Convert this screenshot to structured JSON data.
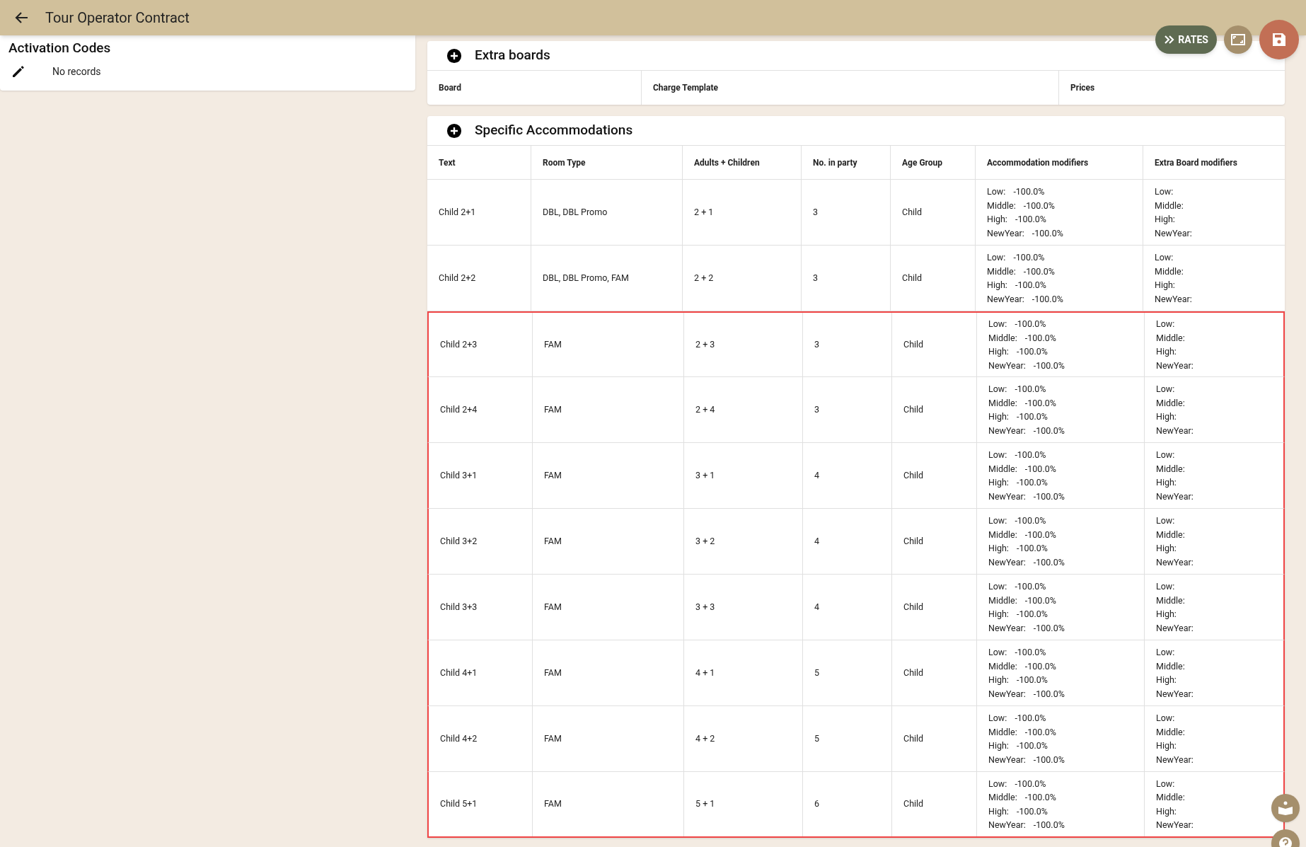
{
  "app_bar": {
    "title": "Tour Operator Contract"
  },
  "actions": [
    {
      "kind": "rates",
      "label": "RATES"
    },
    {
      "kind": "fullscreen"
    },
    {
      "kind": "save"
    }
  ],
  "activation_codes": {
    "title": "Activation Codes",
    "empty_text": "No records"
  },
  "extra_boards": {
    "title": "Extra boards",
    "columns": [
      "Board",
      "Charge Template",
      "Prices"
    ]
  },
  "specific_accommodations": {
    "title": "Specific Accommodations",
    "columns": [
      "Text",
      "Room Type",
      "Adults + Children",
      "No. in party",
      "Age Group",
      "Accommodation modifiers",
      "Extra Board modifiers"
    ],
    "rows": [
      {
        "text": "Child 2+1",
        "room_type": "DBL, DBL Promo",
        "adults_children": "2 + 1",
        "party": "3",
        "age_group": "Child",
        "highlighted": false,
        "acc_modifiers": [
          [
            "Low:",
            "-100.0%"
          ],
          [
            "Middle:",
            "-100.0%"
          ],
          [
            "High:",
            "-100.0%"
          ],
          [
            "NewYear:",
            "-100.0%"
          ]
        ],
        "board_modifiers": [
          "Low:",
          "Middle:",
          "High:",
          "NewYear:"
        ]
      },
      {
        "text": "Child 2+2",
        "room_type": "DBL, DBL Promo, FAM",
        "adults_children": "2 + 2",
        "party": "3",
        "age_group": "Child",
        "highlighted": false,
        "acc_modifiers": [
          [
            "Low:",
            "-100.0%"
          ],
          [
            "Middle:",
            "-100.0%"
          ],
          [
            "High:",
            "-100.0%"
          ],
          [
            "NewYear:",
            "-100.0%"
          ]
        ],
        "board_modifiers": [
          "Low:",
          "Middle:",
          "High:",
          "NewYear:"
        ]
      },
      {
        "text": "Child 2+3",
        "room_type": "FAM",
        "adults_children": "2 + 3",
        "party": "3",
        "age_group": "Child",
        "highlighted": true,
        "acc_modifiers": [
          [
            "Low:",
            "-100.0%"
          ],
          [
            "Middle:",
            "-100.0%"
          ],
          [
            "High:",
            "-100.0%"
          ],
          [
            "NewYear:",
            "-100.0%"
          ]
        ],
        "board_modifiers": [
          "Low:",
          "Middle:",
          "High:",
          "NewYear:"
        ]
      },
      {
        "text": "Child 2+4",
        "room_type": "FAM",
        "adults_children": "2 + 4",
        "party": "3",
        "age_group": "Child",
        "highlighted": true,
        "acc_modifiers": [
          [
            "Low:",
            "-100.0%"
          ],
          [
            "Middle:",
            "-100.0%"
          ],
          [
            "High:",
            "-100.0%"
          ],
          [
            "NewYear:",
            "-100.0%"
          ]
        ],
        "board_modifiers": [
          "Low:",
          "Middle:",
          "High:",
          "NewYear:"
        ]
      },
      {
        "text": "Child 3+1",
        "room_type": "FAM",
        "adults_children": "3 + 1",
        "party": "4",
        "age_group": "Child",
        "highlighted": true,
        "acc_modifiers": [
          [
            "Low:",
            "-100.0%"
          ],
          [
            "Middle:",
            "-100.0%"
          ],
          [
            "High:",
            "-100.0%"
          ],
          [
            "NewYear:",
            "-100.0%"
          ]
        ],
        "board_modifiers": [
          "Low:",
          "Middle:",
          "High:",
          "NewYear:"
        ]
      },
      {
        "text": "Child 3+2",
        "room_type": "FAM",
        "adults_children": "3 + 2",
        "party": "4",
        "age_group": "Child",
        "highlighted": true,
        "acc_modifiers": [
          [
            "Low:",
            "-100.0%"
          ],
          [
            "Middle:",
            "-100.0%"
          ],
          [
            "High:",
            "-100.0%"
          ],
          [
            "NewYear:",
            "-100.0%"
          ]
        ],
        "board_modifiers": [
          "Low:",
          "Middle:",
          "High:",
          "NewYear:"
        ]
      },
      {
        "text": "Child 3+3",
        "room_type": "FAM",
        "adults_children": "3 + 3",
        "party": "4",
        "age_group": "Child",
        "highlighted": true,
        "acc_modifiers": [
          [
            "Low:",
            "-100.0%"
          ],
          [
            "Middle:",
            "-100.0%"
          ],
          [
            "High:",
            "-100.0%"
          ],
          [
            "NewYear:",
            "-100.0%"
          ]
        ],
        "board_modifiers": [
          "Low:",
          "Middle:",
          "High:",
          "NewYear:"
        ]
      },
      {
        "text": "Child 4+1",
        "room_type": "FAM",
        "adults_children": "4 + 1",
        "party": "5",
        "age_group": "Child",
        "highlighted": true,
        "acc_modifiers": [
          [
            "Low:",
            "-100.0%"
          ],
          [
            "Middle:",
            "-100.0%"
          ],
          [
            "High:",
            "-100.0%"
          ],
          [
            "NewYear:",
            "-100.0%"
          ]
        ],
        "board_modifiers": [
          "Low:",
          "Middle:",
          "High:",
          "NewYear:"
        ]
      },
      {
        "text": "Child 4+2",
        "room_type": "FAM",
        "adults_children": "4 + 2",
        "party": "5",
        "age_group": "Child",
        "highlighted": true,
        "acc_modifiers": [
          [
            "Low:",
            "-100.0%"
          ],
          [
            "Middle:",
            "-100.0%"
          ],
          [
            "High:",
            "-100.0%"
          ],
          [
            "NewYear:",
            "-100.0%"
          ]
        ],
        "board_modifiers": [
          "Low:",
          "Middle:",
          "High:",
          "NewYear:"
        ]
      },
      {
        "text": "Child 5+1",
        "room_type": "FAM",
        "adults_children": "5 + 1",
        "party": "6",
        "age_group": "Child",
        "highlighted": true,
        "acc_modifiers": [
          [
            "Low:",
            "-100.0%"
          ],
          [
            "Middle:",
            "-100.0%"
          ],
          [
            "High:",
            "-100.0%"
          ],
          [
            "NewYear:",
            "-100.0%"
          ]
        ],
        "board_modifiers": [
          "Low:",
          "Middle:",
          "High:",
          "NewYear:"
        ]
      }
    ]
  },
  "help_buttons": [
    {
      "kind": "guide"
    },
    {
      "kind": "help"
    }
  ]
}
